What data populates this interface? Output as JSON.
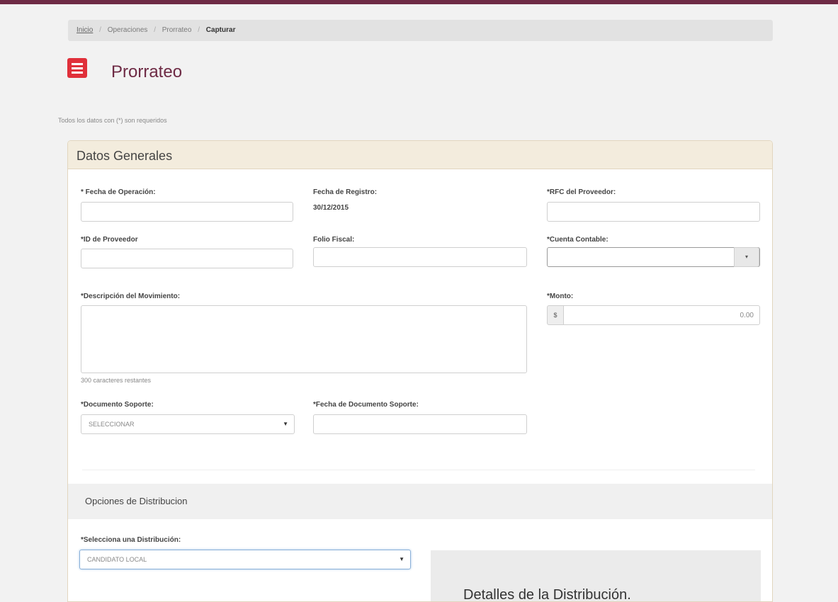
{
  "breadcrumb": {
    "home": "Inicio",
    "items": [
      "Operaciones",
      "Prorrateo"
    ],
    "current": "Capturar"
  },
  "page": {
    "title": "Prorrateo",
    "required_note": "Todos los datos con (*) son requeridos"
  },
  "datos_generales": {
    "header": "Datos Generales",
    "fecha_operacion": {
      "label": "* Fecha de Operación:",
      "value": ""
    },
    "fecha_registro": {
      "label": "Fecha de Registro:",
      "value": "30/12/2015"
    },
    "rfc_proveedor": {
      "label": "*RFC del Proveedor:",
      "value": ""
    },
    "id_proveedor": {
      "label": "*ID de Proveedor",
      "value": ""
    },
    "folio_fiscal": {
      "label": "Folio Fiscal:",
      "value": ""
    },
    "cuenta_contable": {
      "label": "*Cuenta Contable:",
      "value": "",
      "button_icon": "▾"
    },
    "descripcion": {
      "label": "*Descripción del Movimiento:",
      "value": "",
      "remaining": "300 caracteres restantes"
    },
    "monto": {
      "label": "*Monto:",
      "prefix": "$",
      "value": "0.00"
    },
    "documento_soporte": {
      "label": "*Documento Soporte:",
      "selected": "SELECCIONAR"
    },
    "fecha_documento": {
      "label": "*Fecha de Documento Soporte:",
      "value": ""
    }
  },
  "distribucion": {
    "header": "Opciones de Distribucion",
    "select_label": "*Selecciona una Distribución:",
    "selected": "CANDIDATO LOCAL",
    "details_title": "Detalles de la Distribución."
  },
  "colors": {
    "brand": "#6e2b45",
    "icon_red": "#e0303a",
    "header_bg": "#f3ecdd"
  }
}
